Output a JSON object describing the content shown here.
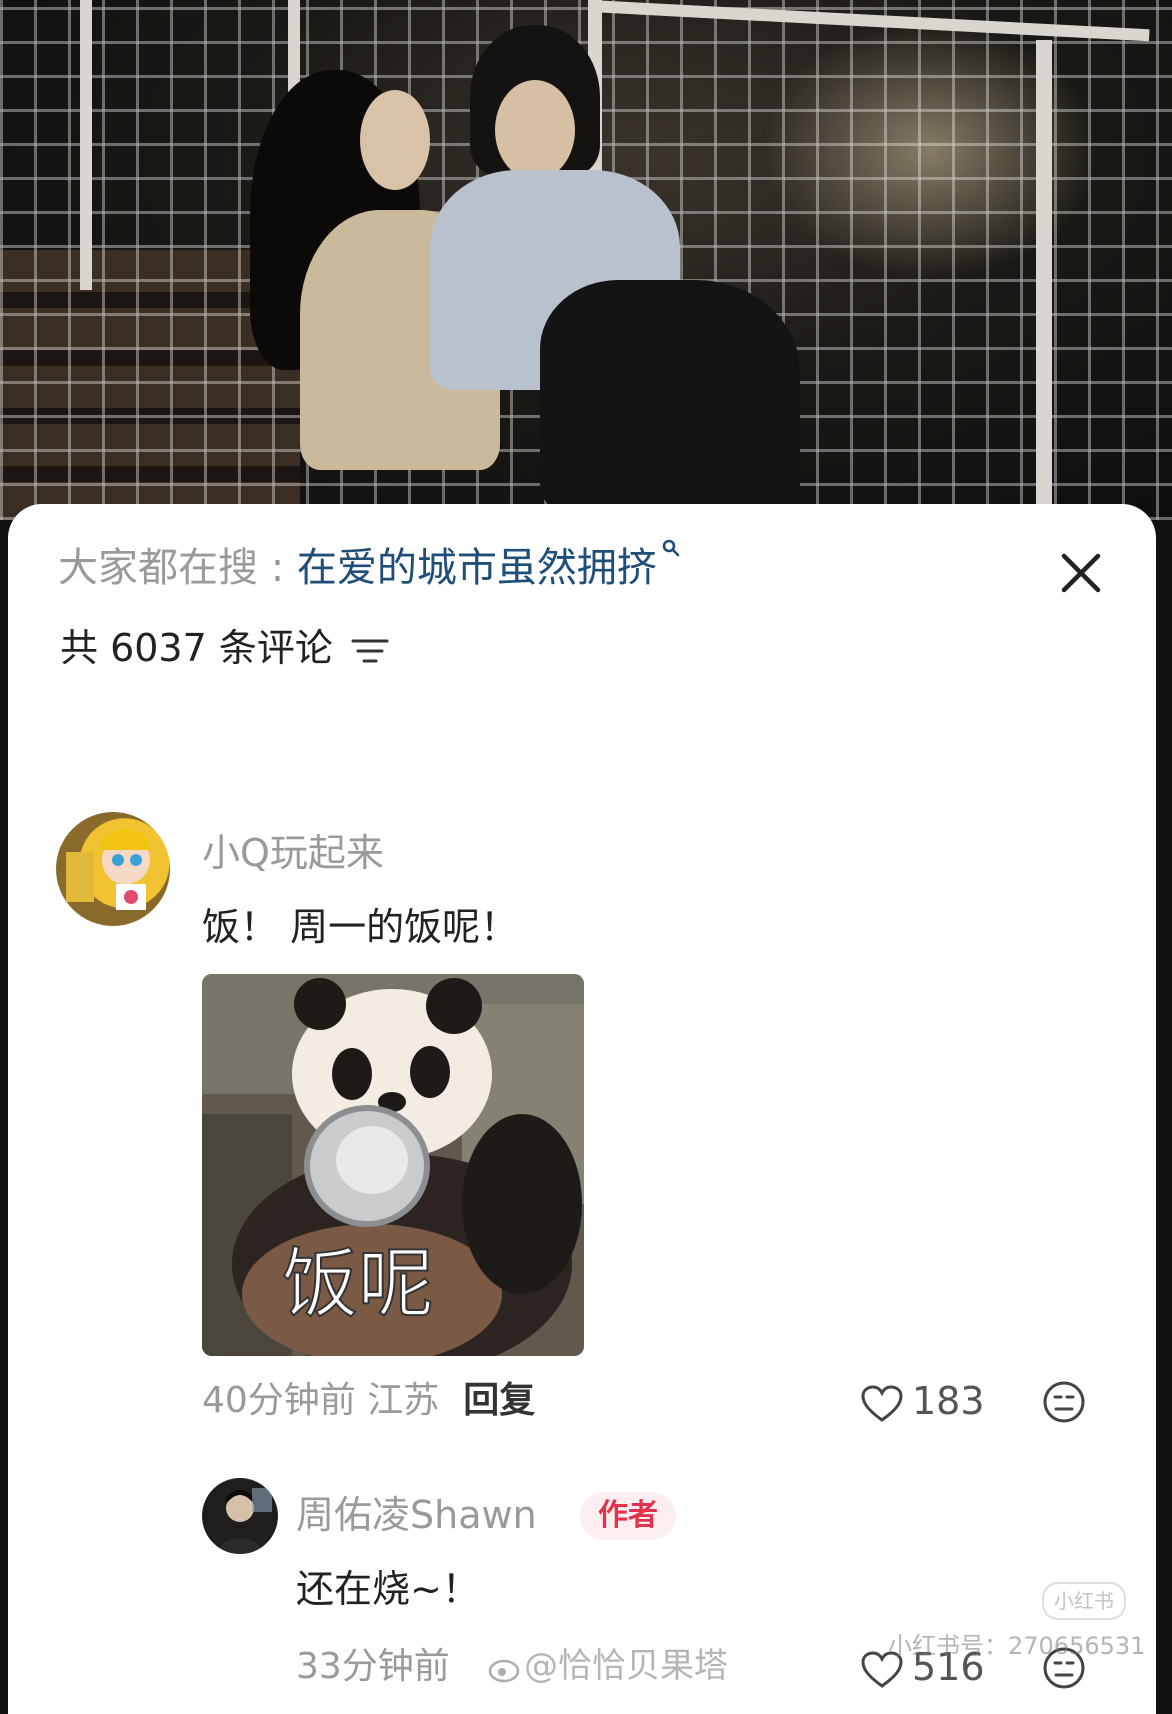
{
  "search": {
    "prefix": "大家都在搜 : ",
    "term": "在爱的城市虽然拥挤"
  },
  "comments_header": {
    "label": "共 6037 条评论"
  },
  "comment": {
    "username": "小Q玩起来",
    "text": "饭！ 周一的饭呢！",
    "sticker_text": "饭呢",
    "time_location": "40分钟前 江苏",
    "reply_label": "回复",
    "likes": "183"
  },
  "reply": {
    "username": "周佑凌Shawn",
    "badge": "作者",
    "text": "还在烧~！",
    "time": "33分钟前",
    "likes": "516"
  },
  "watermarks": {
    "weibo": "@恰恰贝果塔",
    "xhs_id": "小红书号：270656531",
    "xhs_logo": "小红书"
  },
  "icons": {
    "search": "search-icon",
    "close": "close-icon",
    "sort": "sort-icon",
    "like": "heart-icon",
    "react": "emoji-icon"
  }
}
